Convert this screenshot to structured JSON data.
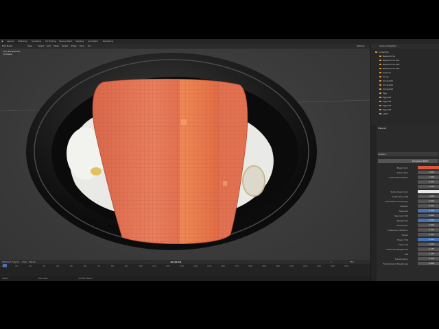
{
  "menu": [
    "Layout",
    "Modeling",
    "Sculpting",
    "UV Editing",
    "Texture Paint",
    "Shading",
    "Animation",
    "Rendering"
  ],
  "viewport": {
    "mode": "Edit Mode",
    "menu": [
      "View",
      "Select",
      "Add",
      "Mesh",
      "Vertex",
      "Edge",
      "Face",
      "UV"
    ],
    "info_line1": "User Perspective",
    "info_line2": "(1) Plane",
    "options": "Options"
  },
  "timeline": {
    "menu": [
      "Playback",
      "Keying",
      "View",
      "Marker"
    ],
    "frames": [
      "0",
      "10",
      "20",
      "30",
      "40",
      "50",
      "60",
      "70",
      "80",
      "90",
      "100",
      "110",
      "120",
      "130",
      "140",
      "150",
      "160",
      "170",
      "180",
      "190",
      "200",
      "210",
      "220",
      "230",
      "240",
      "250"
    ],
    "current_frame": "1",
    "start": "1",
    "end": "250"
  },
  "statusbar": [
    "Select",
    "Pan View",
    "Context Menu"
  ],
  "outliner": {
    "title": "Scene Collection",
    "rows": [
      "Collection",
      "BezierCircle",
      "BezierCircle.001",
      "BezierCircle.002",
      "BezierCircle.003",
      "Camera",
      "Circle",
      "Circle.001",
      "Circle.002",
      "Circle.003",
      "Egg",
      "Egg.001",
      "Egg.002",
      "Egg.003",
      "Egg.004",
      "Light"
    ]
  },
  "properties": {
    "material_name": "Material",
    "surface": "Surface",
    "surface_type": "Principled BSDF",
    "rows": [
      {
        "label": "Base Color",
        "value": ""
      },
      {
        "label": "Subsurface",
        "value": "0.000"
      },
      {
        "label": "Subsurface Radius",
        "value": "1.000"
      },
      {
        "label": "",
        "value": "0.200"
      },
      {
        "label": "",
        "value": "0.100"
      },
      {
        "label": "Subsurface Color",
        "value": ""
      },
      {
        "label": "Subsurface IOR",
        "value": "1.400"
      },
      {
        "label": "Subsurface Anisotropy",
        "value": "0.000"
      },
      {
        "label": "Metallic",
        "value": "0.000"
      },
      {
        "label": "Specular",
        "value": "0.500"
      },
      {
        "label": "Specular Tint",
        "value": "0.000"
      },
      {
        "label": "Roughness",
        "value": "0.500"
      },
      {
        "label": "Anisotropic",
        "value": "0.000"
      },
      {
        "label": "Anisotropic Rotation",
        "value": "0.000"
      },
      {
        "label": "Sheen",
        "value": "0.000"
      },
      {
        "label": "Sheen Tint",
        "value": "0.500"
      },
      {
        "label": "Clearcoat",
        "value": "0.000"
      },
      {
        "label": "Clearcoat Roughness",
        "value": "0.030"
      },
      {
        "label": "IOR",
        "value": "1.450"
      },
      {
        "label": "Transmission",
        "value": "0.000"
      },
      {
        "label": "Transmission Roughness",
        "value": "0.000"
      }
    ]
  },
  "colors": {
    "salmon": "#e8734f",
    "plate": "#151515",
    "base_color": "#d9573a"
  }
}
